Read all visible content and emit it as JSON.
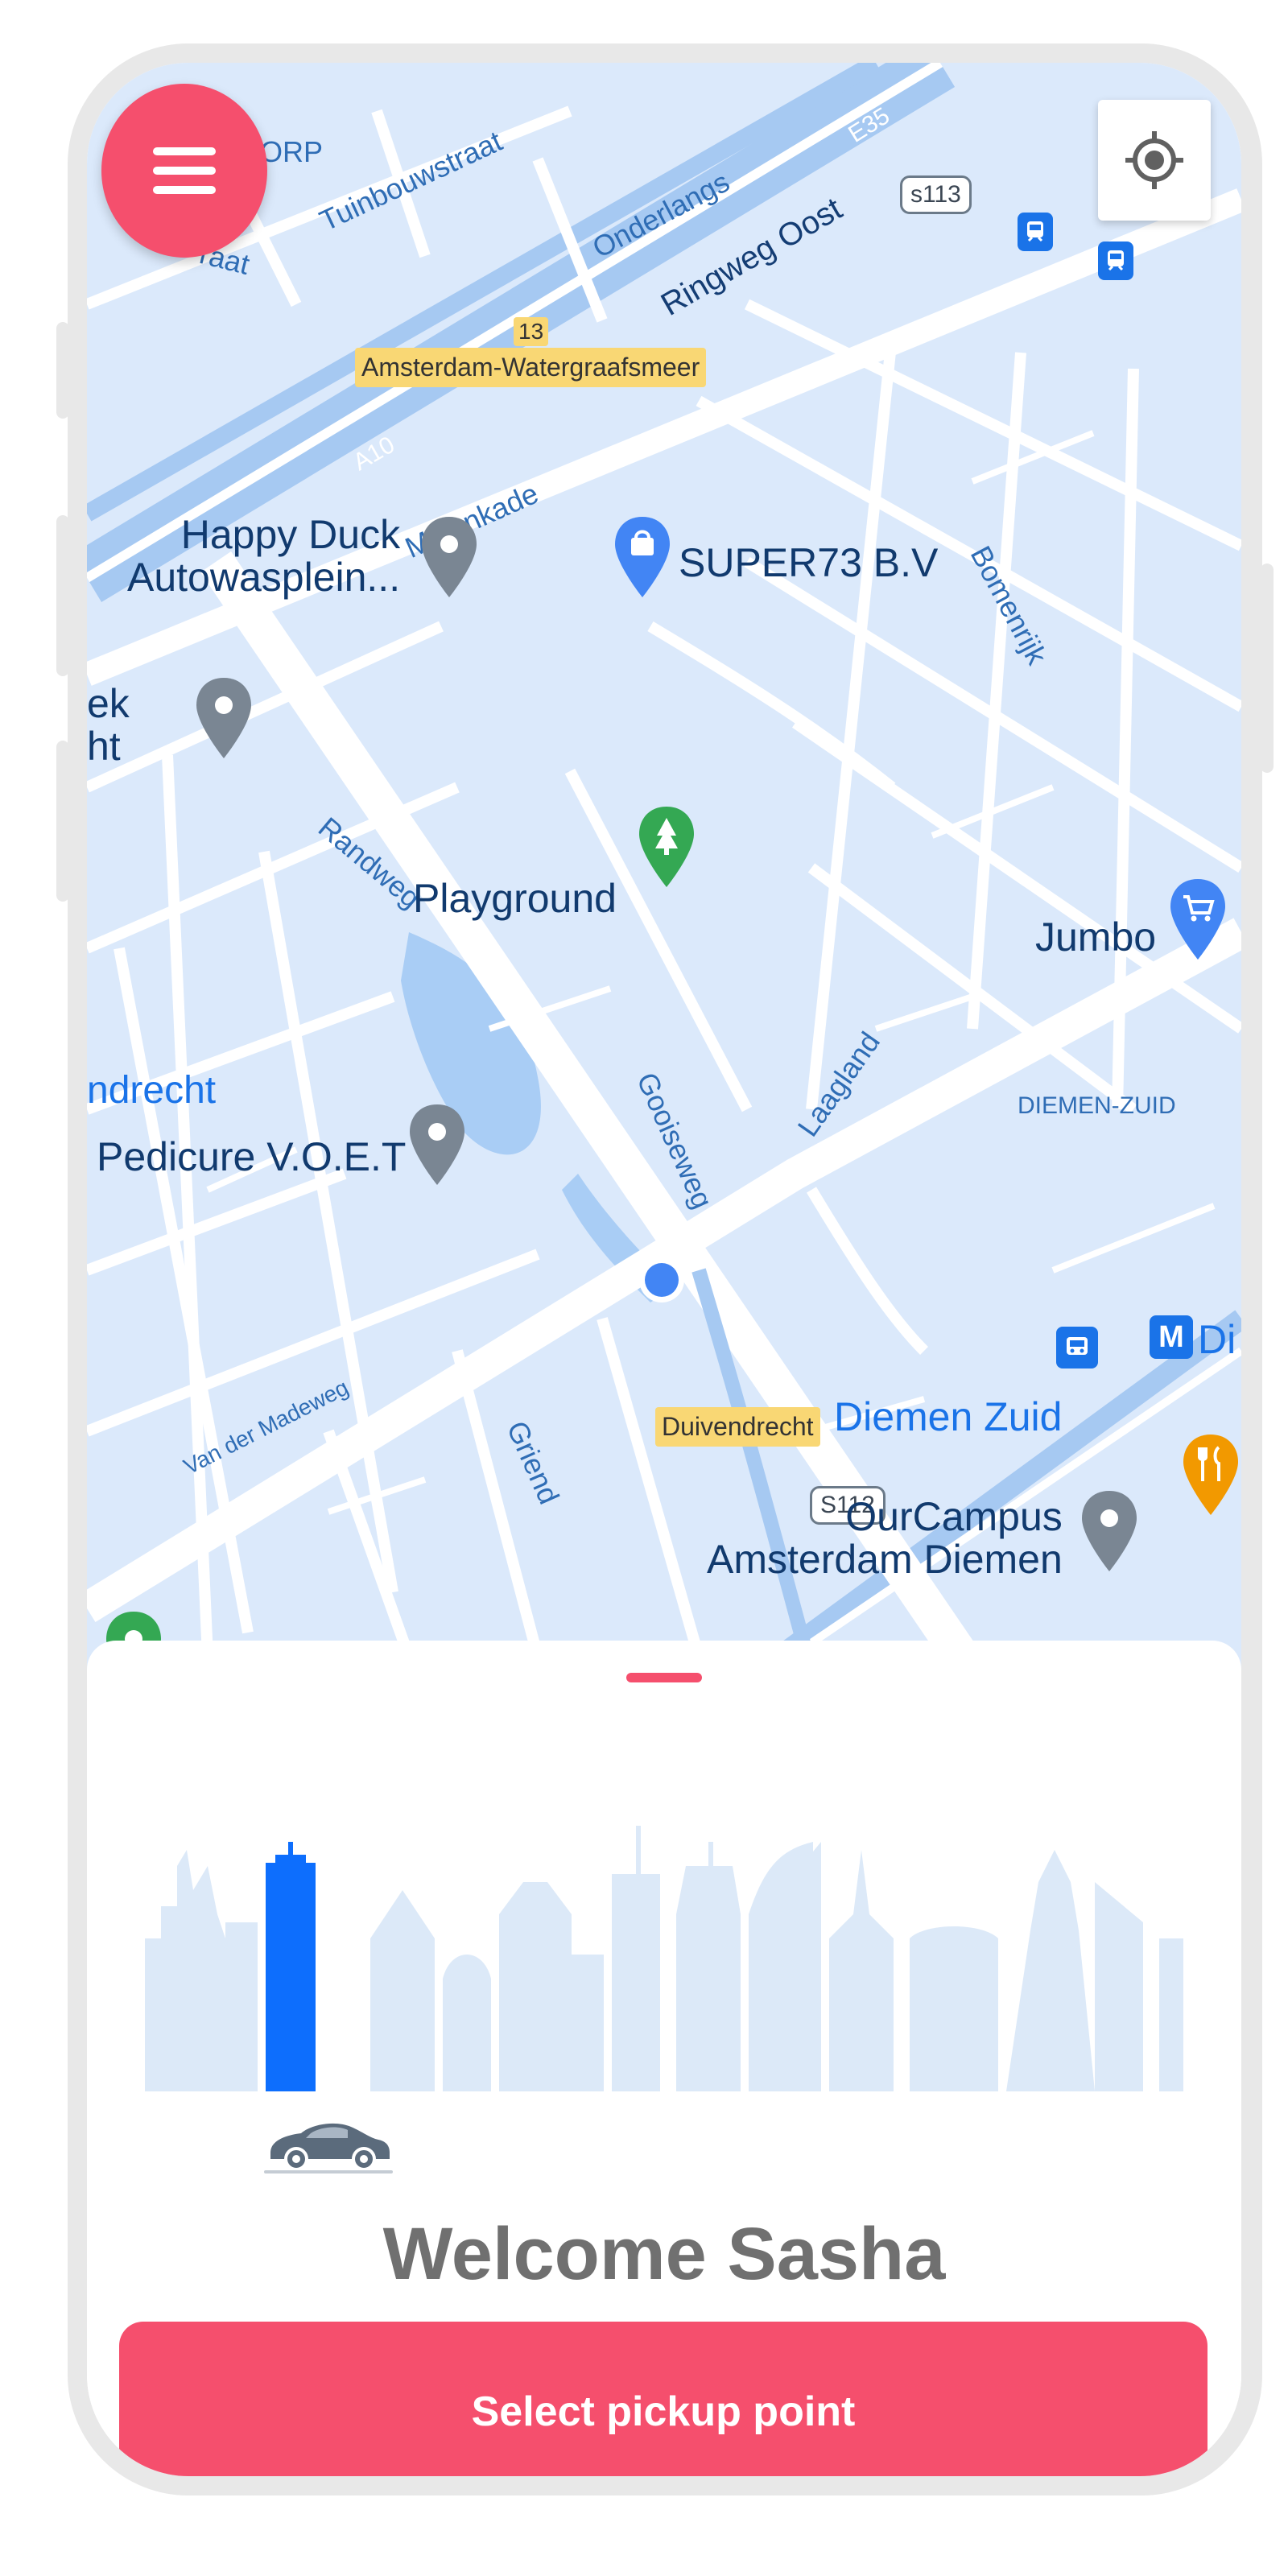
{
  "map": {
    "streets": {
      "tuinbouwstraat": "Tuinbouwstraat",
      "onderlangs": "Onderlangs",
      "ringweg_oost": "Ringweg Oost",
      "molenkade": "Molenkade",
      "bomenrijk": "Bomenrijk",
      "randweg": "Randweg",
      "gooiseweg": "Gooiseweg",
      "laagland": "Laagland",
      "van_der_madeweg": "Van der Madeweg",
      "griend": "Griend",
      "a10": "A10",
      "dorp_fragment": "ORP",
      "straat_fragment": "raat"
    },
    "areas": {
      "watergraafsmeer": "Amsterdam-Watergraafsmeer",
      "duivendrecht": "Duivendrecht",
      "diemen_zuid_district": "DIEMEN-ZUID",
      "ndrecht": "ndrecht"
    },
    "shields": {
      "s113": "s113",
      "s112": "S112",
      "exit13": "13",
      "e35": "E35"
    },
    "pois": {
      "happy_duck": "Happy Duck\nAutowasplein...",
      "super73": "SUPER73 B.V",
      "playground": "Playground",
      "jumbo": "Jumbo",
      "pedicure": "Pedicure V.O.E.T",
      "diemen_zuid": "Diemen Zuid",
      "ourcampus": "OurCampus\nAmsterdam Diemen",
      "ek_fragment": "ek\nht",
      "di_fragment": "Di"
    },
    "icons": {
      "menu": "menu-icon",
      "locate": "locate-icon",
      "current_location": "current-location-dot"
    }
  },
  "sheet": {
    "welcome": "Welcome Sasha",
    "cta_label": "Select pickup point",
    "illustration": "city-skyline-with-car"
  },
  "colors": {
    "accent": "#f54f6d",
    "highlight_building": "#0d6efd",
    "skyline": "#dce9f8",
    "map_bg": "#dbe9fb"
  }
}
